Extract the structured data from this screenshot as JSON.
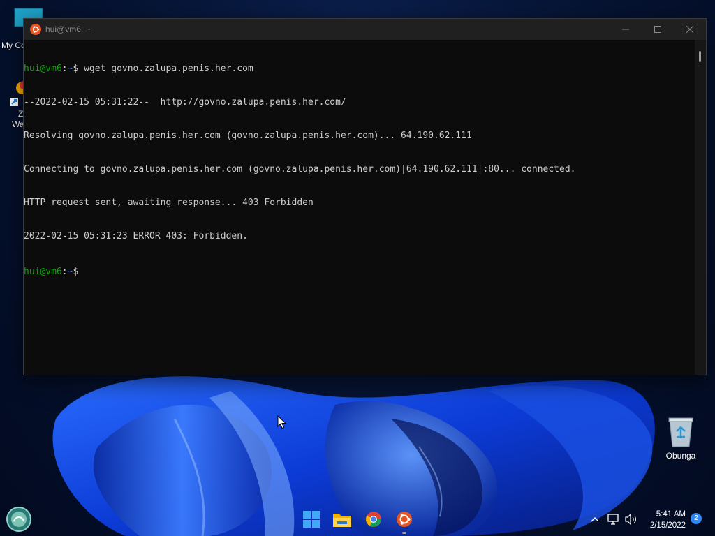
{
  "colors": {
    "terminal_bg": "#0c0c0c",
    "prompt_user": "#13a10e",
    "prompt_path": "#3b78ff",
    "ubuntu_orange": "#e95420",
    "accent_blue": "#2f8af5"
  },
  "desktop": {
    "icons": [
      {
        "label": "My Co",
        "icon": "computer-icon"
      },
      {
        "label": "Ze",
        "icon": "shortcut-icon"
      },
      {
        "label": "Wall",
        "icon": "shortcut-icon"
      },
      {
        "label": "Obunga",
        "icon": "recycle-bin-icon"
      }
    ]
  },
  "window": {
    "title": "hui@vm6: ~",
    "icon": "ubuntu-icon"
  },
  "terminal": {
    "prompt_user": "hui@vm6",
    "prompt_sep": ":",
    "prompt_path": "~",
    "prompt_symbol": "$",
    "command": " wget govno.zalupa.penis.her.com",
    "output": [
      "--2022-02-15 05:31:22--  http://govno.zalupa.penis.her.com/",
      "Resolving govno.zalupa.penis.her.com (govno.zalupa.penis.her.com)... 64.190.62.111",
      "Connecting to govno.zalupa.penis.her.com (govno.zalupa.penis.her.com)|64.190.62.111|:80... connected.",
      "HTTP request sent, awaiting response... 403 Forbidden",
      "2022-02-15 05:31:23 ERROR 403: Forbidden."
    ]
  },
  "taskbar": {
    "apps": [
      "start-icon",
      "file-explorer-icon",
      "chrome-icon",
      "ubuntu-terminal-icon"
    ],
    "time": "5:41 AM",
    "date": "2/15/2022",
    "notifications": "2"
  }
}
